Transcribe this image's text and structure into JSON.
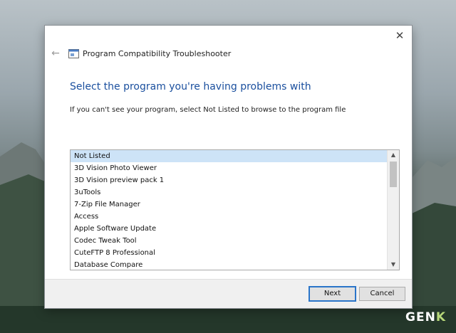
{
  "dialog": {
    "title": "Program Compatibility Troubleshooter",
    "heading": "Select the program you're having problems with",
    "subtext": "If you can't see your program, select Not Listed to browse to the program file",
    "close_glyph": "✕",
    "back_glyph": "←"
  },
  "program_list": {
    "selected": "Not Listed",
    "items": [
      "Not Listed",
      "3D Vision Photo Viewer",
      "3D Vision preview pack 1",
      "3uTools",
      "7-Zip File Manager",
      "Access",
      "Apple Software Update",
      "Codec Tweak Tool",
      "CuteFTP 8 Professional",
      "Database Compare"
    ]
  },
  "buttons": {
    "next": "Next",
    "cancel": "Cancel"
  },
  "watermark": {
    "text_main": "GEN",
    "text_accent": "K"
  },
  "colors": {
    "heading": "#1a4f9e",
    "selection": "#cde3f7",
    "primary_border": "#2a75c9"
  }
}
